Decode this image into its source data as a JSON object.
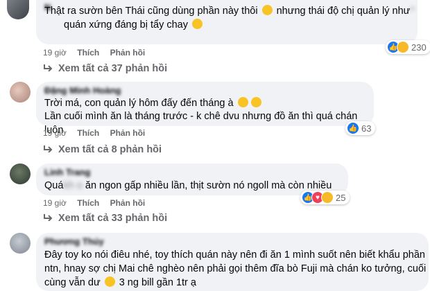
{
  "comments": [
    {
      "name": "N",
      "lines": [
        "Thật ra sườn bên Thái cũng dùng phần này thôi",
        "nhưng thái độ chị quản lý như",
        "quán xứng đáng bị tẩy chay"
      ],
      "time": "19 giờ",
      "like_label": "Thích",
      "reply_label": "Phản hồi",
      "reaction_count": "230",
      "replies_link": "Xem tất cả 37 phản hồi"
    },
    {
      "name": "Đặng Minh Hoàng",
      "lines": [
        "Trời má, con quản lý hôm đấy đến tháng à",
        "Lần cuối mình ăn là tháng trước - k chê dvu nhưng đồ ăn thì quá chán luôn"
      ],
      "time": "19 giờ",
      "like_label": "Thích",
      "reply_label": "Phản hồi",
      "reaction_count": "63",
      "replies_link": "Xem tất cả 8 phản hồi"
    },
    {
      "name": "Linh Trang",
      "lines": [
        "Quá",
        "ăn ngon gấp nhiều lần, thịt sườn nó ngoll mà còn nhiều"
      ],
      "time": "19 giờ",
      "like_label": "Thích",
      "reply_label": "Phản hồi",
      "reaction_count": "25",
      "replies_link": "Xem tất cả 33 phản hồi"
    },
    {
      "name": "Phương Thúy",
      "lines": [
        "Đây toy ko nói điêu nhé, toy thích quán này nên đi ăn 1 mình suốt nên biết khẩu phần",
        "ntn, hnay sợ chị Mai chê nghèo nên phải gọi thêm đĩa bò Fuji mà chán ko tưởng, cuối",
        "cùng vẫn dư",
        "3 ng bill gần 1tr ạ"
      ]
    }
  ],
  "colors": {
    "bubble": "#f0f2f5",
    "meta": "#65676b",
    "like": "#1877f2",
    "haha": "#f7b928",
    "love": "#f33e58"
  }
}
